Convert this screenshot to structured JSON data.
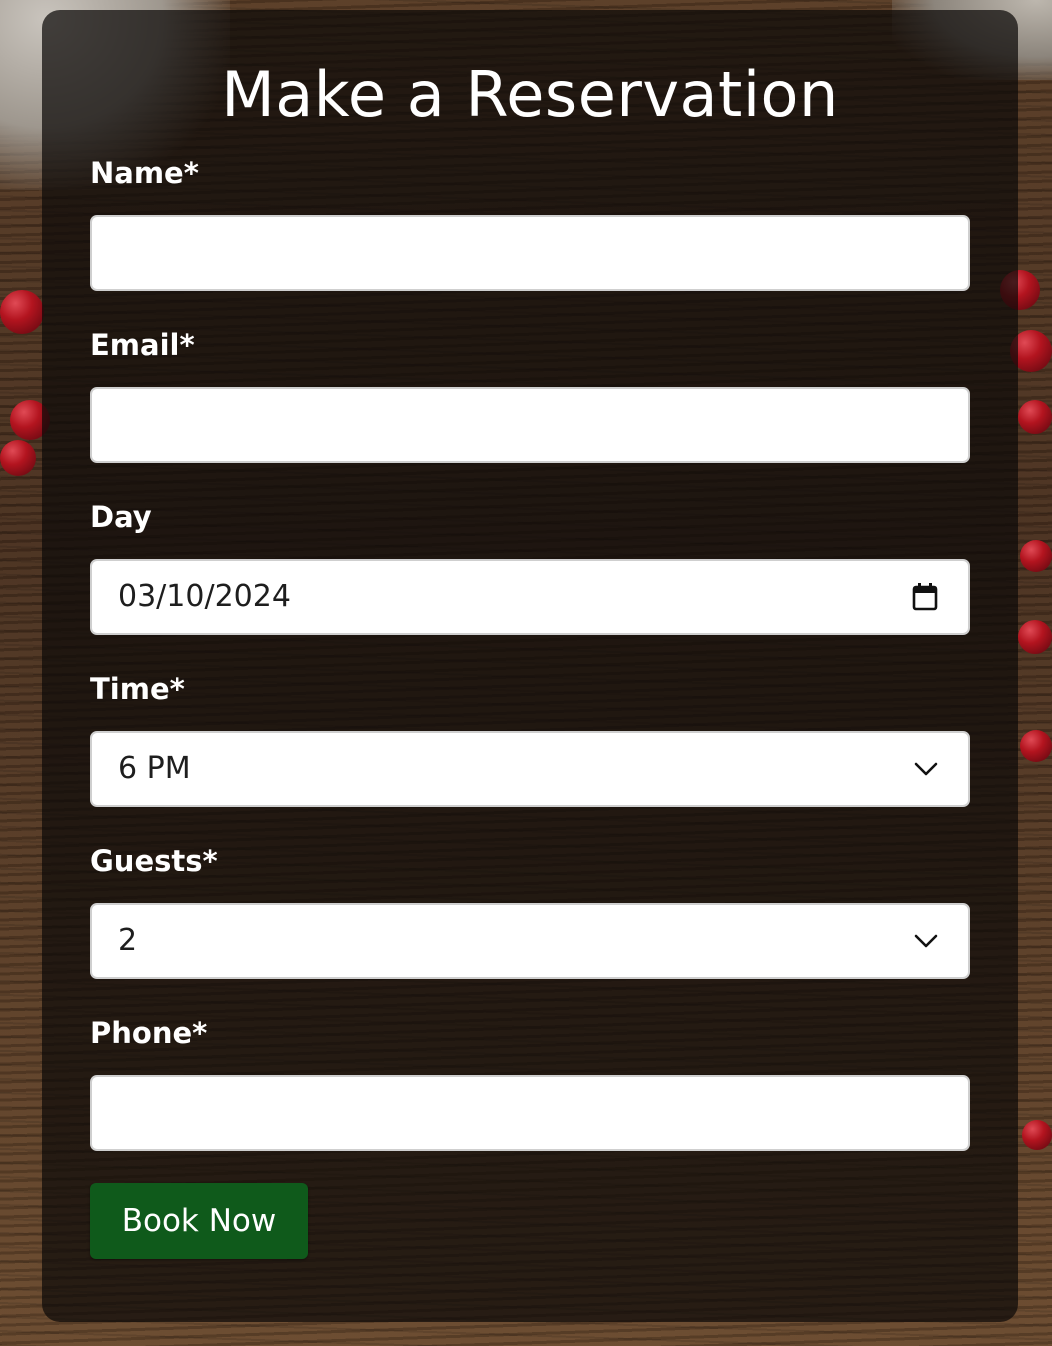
{
  "form": {
    "title": "Make a Reservation",
    "name": {
      "label": "Name*",
      "value": ""
    },
    "email": {
      "label": "Email*",
      "value": ""
    },
    "day": {
      "label": "Day",
      "value": "03/10/2024"
    },
    "time": {
      "label": "Time*",
      "value": "6 PM"
    },
    "guests": {
      "label": "Guests*",
      "value": "2"
    },
    "phone": {
      "label": "Phone*",
      "value": ""
    },
    "submit_label": "Book Now"
  },
  "colors": {
    "button": "#0f5a1b",
    "panel": "rgba(12,10,9,0.72)"
  },
  "icons": {
    "day": "calendar-icon",
    "time": "chevron-down-icon",
    "guests": "chevron-down-icon"
  }
}
